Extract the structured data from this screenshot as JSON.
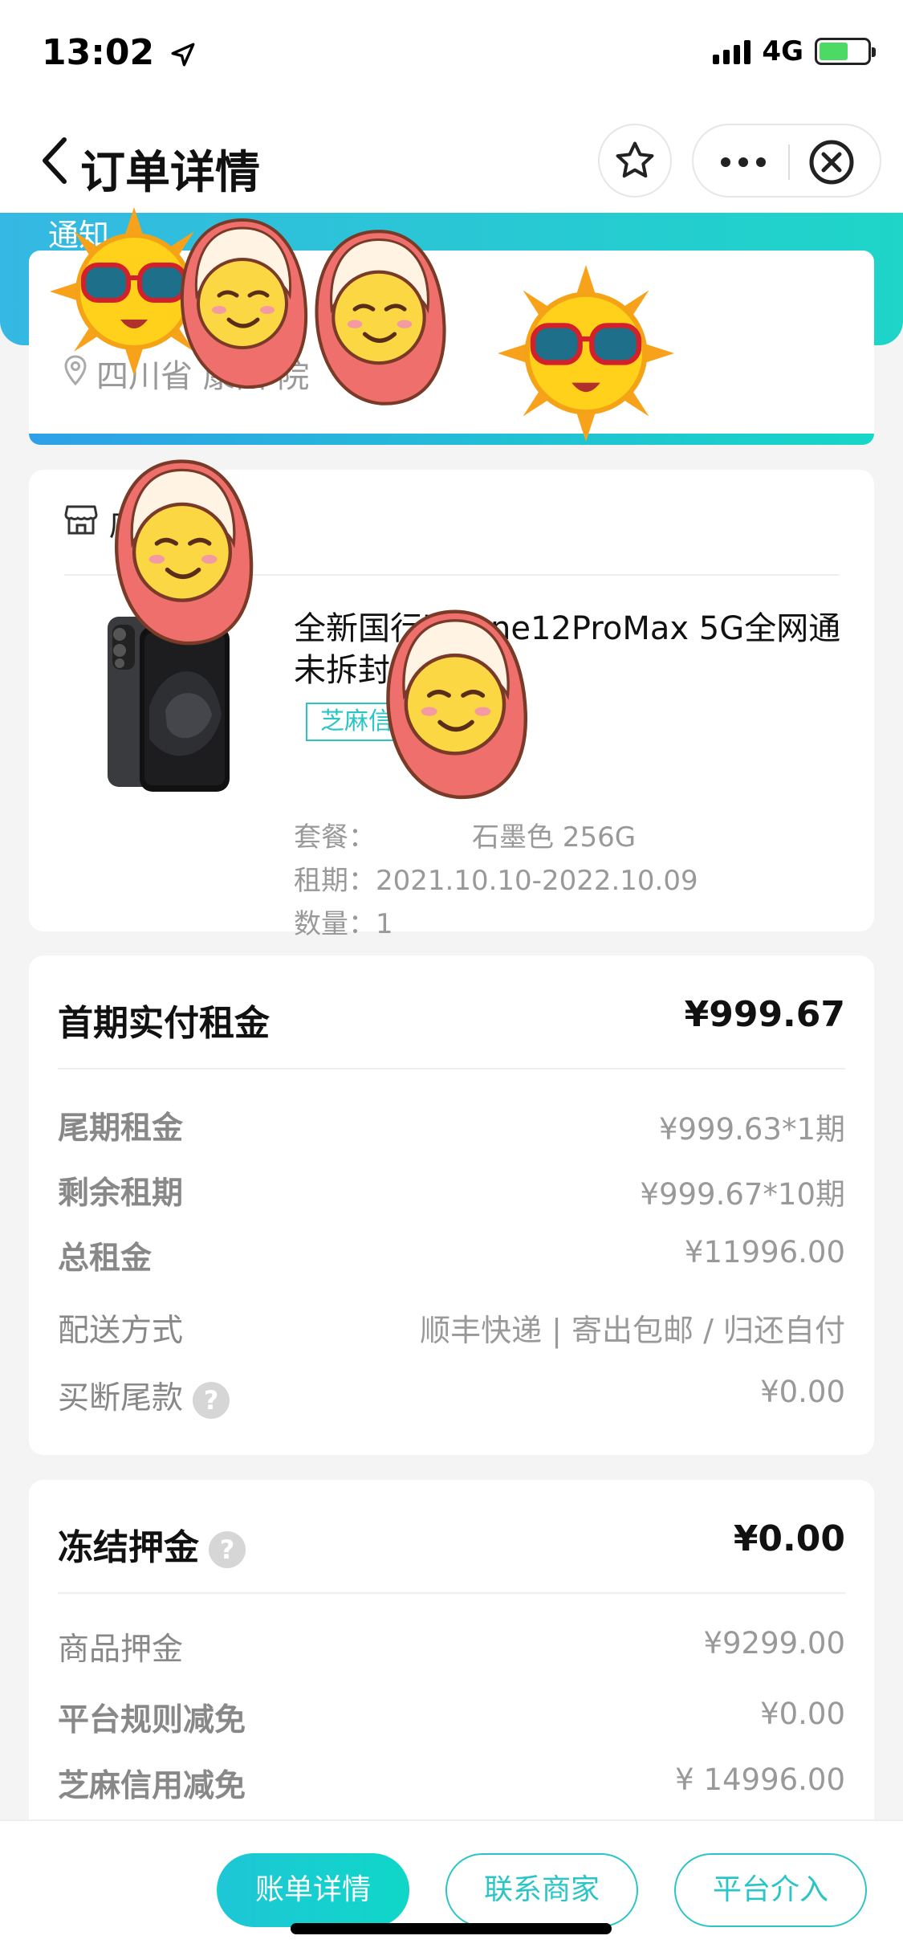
{
  "status_bar": {
    "time": "13:02",
    "network": "4G"
  },
  "nav": {
    "title": "订单详情"
  },
  "header": {
    "notice": "通知"
  },
  "address": {
    "name": "",
    "phone": "4",
    "line": "四川省                   康西            院"
  },
  "store": {
    "name": "店"
  },
  "product": {
    "title": "全新国行iPhone12ProMax 5G全网通未拆封",
    "tag": "芝麻信用免押",
    "package_label": "套餐：",
    "package_value": "石墨色 256G",
    "period_label": "租期：",
    "period_value": "2021.10.10-2022.10.09",
    "quantity_label": "数量：",
    "quantity_value": "1"
  },
  "rent": {
    "first_label": "首期实付租金",
    "first_value": "¥999.67",
    "rows": [
      {
        "label": "尾期租金",
        "value": "¥999.63*1期"
      },
      {
        "label": "剩余租期",
        "value": "¥999.67*10期"
      },
      {
        "label": "总租金",
        "value": "¥11996.00"
      },
      {
        "label": "配送方式",
        "value": "顺丰快递 | 寄出包邮 / 归还自付"
      },
      {
        "label": "买断尾款",
        "value": "¥0.00"
      }
    ]
  },
  "deposit": {
    "label": "冻结押金",
    "value": "¥0.00",
    "rows": [
      {
        "label": "商品押金",
        "value": "¥9299.00"
      },
      {
        "label": "平台规则减免",
        "value": "¥0.00"
      },
      {
        "label": "芝麻信用减免",
        "value": "¥ 14996.00"
      }
    ]
  },
  "actions": {
    "bill": "账单详情",
    "contact": "联系商家",
    "platform": "平台介入"
  },
  "help_glyph": "?",
  "colors": {
    "accent": "#2bc5c6",
    "header_start": "#35b8e3",
    "header_end": "#1ed5c8"
  }
}
